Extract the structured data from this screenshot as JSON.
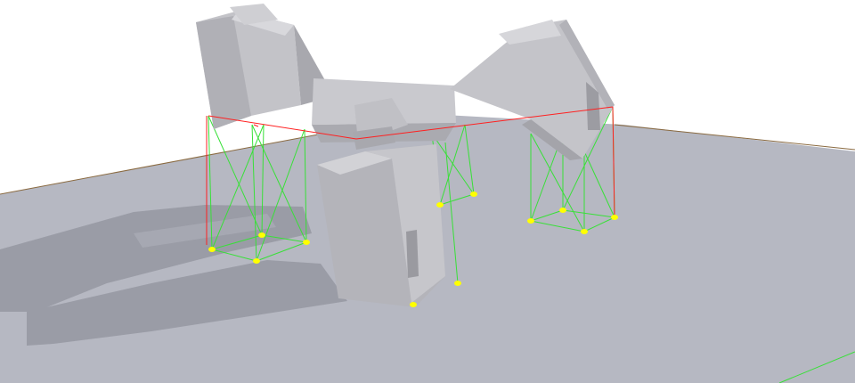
{
  "viewport": {
    "description_free": true,
    "background_color": "#ffffff",
    "ground_color": "#b6b8c2",
    "shadow_color": "#9a9ca6",
    "block_face_light": "#cfcfd3",
    "block_face_mid": "#b8b8bd",
    "block_face_dark": "#9c9ca2",
    "joint_color": "#ff2020",
    "link_color": "#38e038",
    "contact_point_color": "#ffff00"
  }
}
